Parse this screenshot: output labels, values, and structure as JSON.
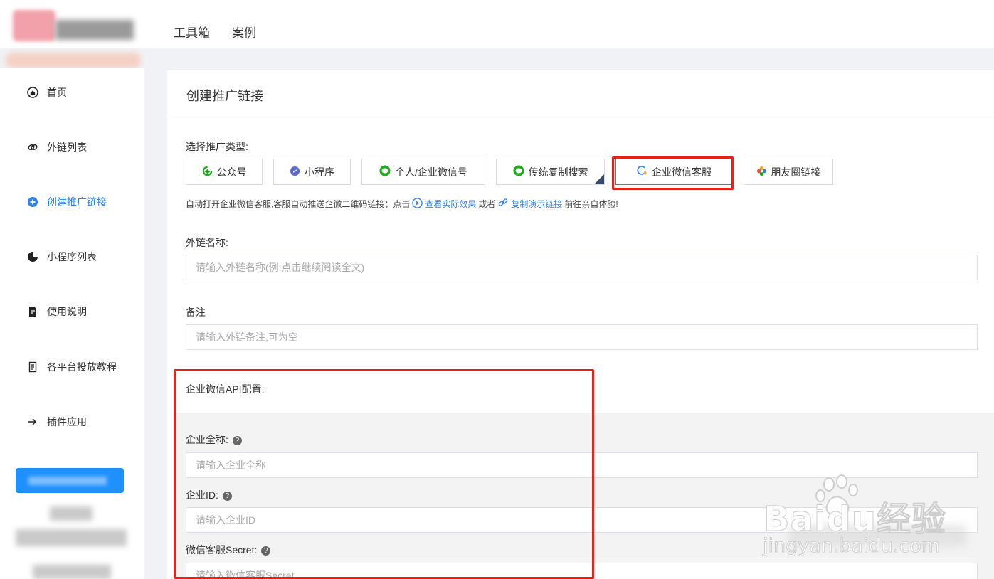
{
  "topnav": {
    "items": [
      "工具箱",
      "案例"
    ]
  },
  "sidebar": {
    "items": [
      {
        "label": "首页",
        "icon": "home-icon"
      },
      {
        "label": "外链列表",
        "icon": "link-icon"
      },
      {
        "label": "创建推广链接",
        "icon": "plus-circle-icon",
        "active": true
      },
      {
        "label": "小程序列表",
        "icon": "mini-program-icon"
      },
      {
        "label": "使用说明",
        "icon": "document-icon"
      },
      {
        "label": "各平台投放教程",
        "icon": "tutorial-icon"
      },
      {
        "label": "插件应用",
        "icon": "plugin-arrow-icon"
      }
    ]
  },
  "main": {
    "title": "创建推广链接",
    "type_label": "选择推广类型:",
    "types": [
      {
        "label": "公众号",
        "color": "#1aad19"
      },
      {
        "label": "小程序",
        "color": "#5b6bd6"
      },
      {
        "label": "个人/企业微信号",
        "color": "#1aad19"
      },
      {
        "label": "传统复制搜索",
        "color": "#1aad19"
      },
      {
        "label": "企业微信客服",
        "color": "#2f80ed",
        "selected": true
      },
      {
        "label": "朋友圈链接",
        "color": "#f5a623"
      }
    ],
    "hint": {
      "prefix": "自动打开企业微信客服,客服自动推送企微二维码链接；点击",
      "link1": "查看实际效果",
      "mid": "或者",
      "link2": "复制演示链接",
      "suffix": "前往亲自体验!"
    },
    "name_label": "外链名称:",
    "name_placeholder": "请输入外链名称(例:点击继续阅读全文)",
    "remark_label": "备注",
    "remark_placeholder": "请输入外链备注,可为空",
    "api_title": "企业微信API配置:",
    "company_name_label": "企业全称:",
    "company_name_placeholder": "请输入企业全称",
    "company_id_label": "企业ID:",
    "company_id_placeholder": "请输入企业ID",
    "secret_label": "微信客服Secret:",
    "secret_placeholder": "请输入微信客服Secret"
  },
  "watermark": {
    "text": "Baidu经验",
    "url": "jingyan.baidu.com"
  },
  "colors": {
    "accent": "#2f80ed",
    "highlight_box": "#e2231a"
  }
}
